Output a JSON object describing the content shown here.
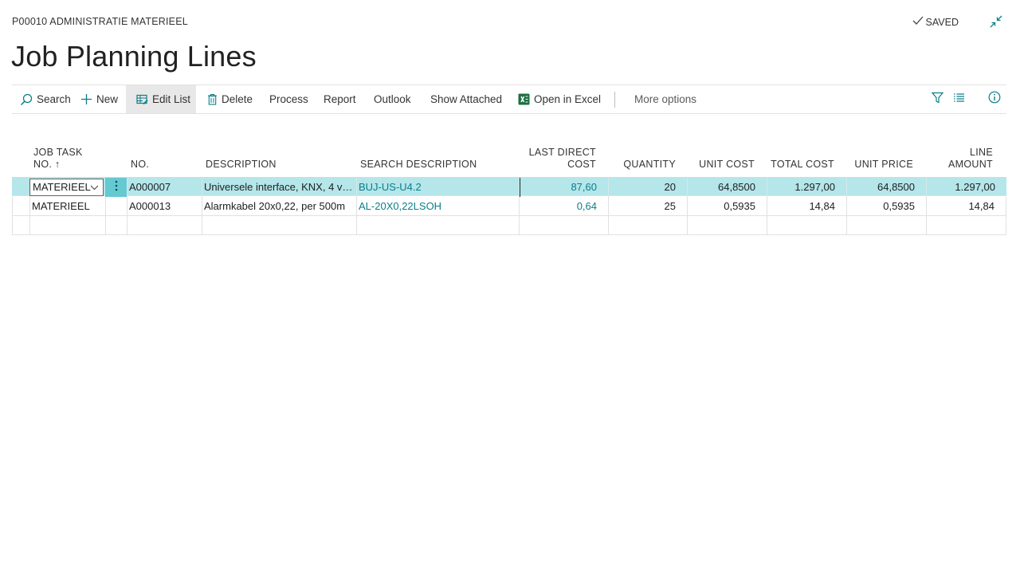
{
  "header": {
    "breadcrumb": "P00010 ADMINISTRATIE MATERIEEL",
    "saved_label": "SAVED",
    "title": "Job Planning Lines"
  },
  "toolbar": {
    "search": "Search",
    "new": "New",
    "edit_list": "Edit List",
    "delete": "Delete",
    "process": "Process",
    "report": "Report",
    "outlook": "Outlook",
    "show_attached": "Show Attached",
    "open_in_excel": "Open in Excel",
    "more_options": "More options"
  },
  "table": {
    "columns": {
      "job_task_no_line1": "JOB TASK",
      "job_task_no_line2": "NO.",
      "sort_arrow": "↑",
      "no": "NO.",
      "description": "DESCRIPTION",
      "search_description": "SEARCH DESCRIPTION",
      "last_direct_cost_line1": "LAST DIRECT",
      "last_direct_cost_line2": "COST",
      "quantity": "QUANTITY",
      "unit_cost": "UNIT COST",
      "total_cost": "TOTAL COST",
      "unit_price": "UNIT PRICE",
      "line_amount_line1": "LINE",
      "line_amount_line2": "AMOUNT"
    },
    "rows": [
      {
        "job_task_no": "MATERIEEL",
        "no": "A000007",
        "description": "Universele interface, KNX, 4 vo...",
        "search_description": "BUJ-US-U4.2",
        "last_direct_cost": "87,60",
        "quantity": "20",
        "unit_cost": "64,8500",
        "total_cost": "1.297,00",
        "unit_price": "64,8500",
        "line_amount": "1.297,00"
      },
      {
        "job_task_no": "MATERIEEL",
        "no": "A000013",
        "description": "Alarmkabel 20x0,22, per 500m",
        "search_description": "AL-20X0,22LSOH",
        "last_direct_cost": "0,64",
        "quantity": "25",
        "unit_cost": "0,5935",
        "total_cost": "14,84",
        "unit_price": "0,5935",
        "line_amount": "14,84"
      }
    ]
  },
  "colors": {
    "accent": "#0b7e8a",
    "selected_row": "#b4e6ea",
    "excel_green": "#1d6f42"
  },
  "icons": {
    "saved": "checkmark-icon",
    "collapse": "collapse-arrows-icon",
    "search": "search-icon",
    "new": "plus-icon",
    "edit_list": "edit-list-icon",
    "delete": "trash-icon",
    "excel": "excel-icon",
    "filter": "filter-icon",
    "list": "list-icon",
    "info": "info-icon",
    "dropdown": "chevron-down-icon",
    "row_menu": "more-vertical-icon"
  }
}
